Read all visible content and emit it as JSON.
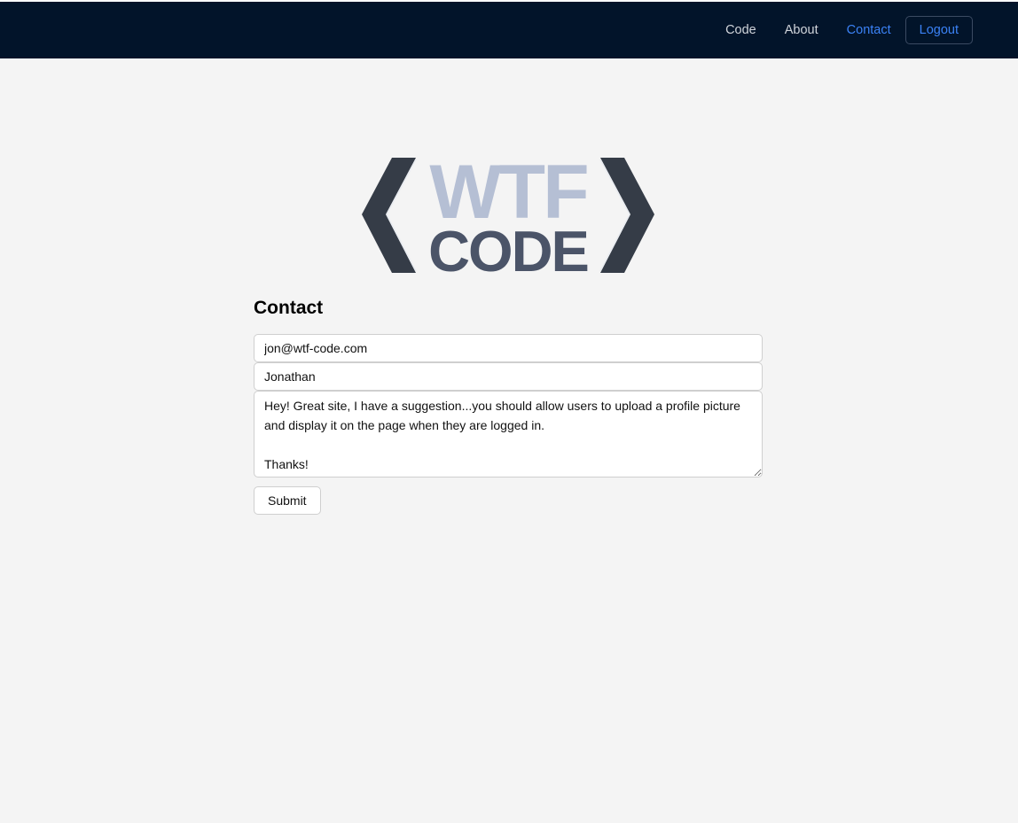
{
  "nav": {
    "links": [
      "Code",
      "About",
      "Contact"
    ],
    "active": "Contact",
    "logout_label": "Logout"
  },
  "logo": {
    "line1": "WTF",
    "line2": "CODE"
  },
  "contact": {
    "title": "Contact",
    "email_value": "jon@wtf-code.com",
    "name_value": "Jonathan",
    "message_value": "Hey! Great site, I have a suggestion...you should allow users to upload a profile picture and display it on the page when they are logged in.\n\nThanks!",
    "submit_label": "Submit"
  },
  "colors": {
    "topbar": "#02142a",
    "accent": "#3b82f6",
    "background": "#f4f4f4"
  }
}
